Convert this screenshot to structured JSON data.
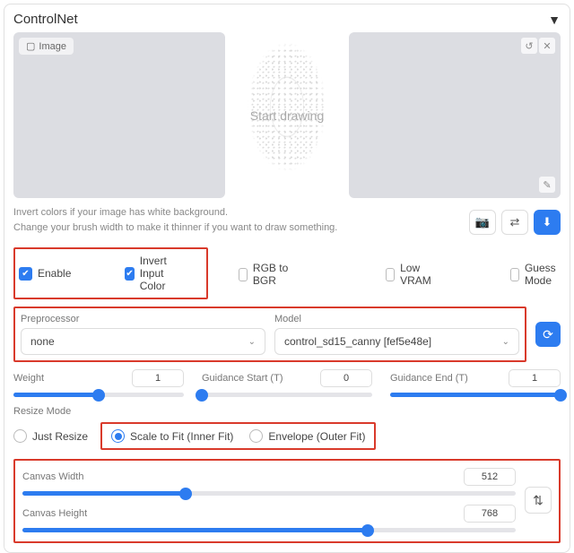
{
  "header": {
    "title": "ControlNet"
  },
  "canvas": {
    "image_chip": "Image",
    "placeholder": "Start drawing"
  },
  "hint": {
    "line1": "Invert colors if your image has white background.",
    "line2": "Change your brush width to make it thinner if you want to draw something."
  },
  "action_buttons": {
    "camera": "📷",
    "swap": "⇄",
    "info": "⬇"
  },
  "checks": {
    "enable": "Enable",
    "invert": "Invert Input Color",
    "rgb": "RGB to BGR",
    "lowvram": "Low VRAM",
    "guess": "Guess Mode"
  },
  "preproc": {
    "label": "Preprocessor",
    "value": "none"
  },
  "model": {
    "label": "Model",
    "value": "control_sd15_canny [fef5e48e]"
  },
  "sliders": {
    "weight": {
      "label": "Weight",
      "value": "1",
      "pct": 50
    },
    "gstart": {
      "label": "Guidance Start (T)",
      "value": "0",
      "pct": 0
    },
    "gend": {
      "label": "Guidance End (T)",
      "value": "1",
      "pct": 100
    }
  },
  "resize": {
    "label": "Resize Mode",
    "just": "Just Resize",
    "scale": "Scale to Fit (Inner Fit)",
    "env": "Envelope (Outer Fit)"
  },
  "canvas_dims": {
    "width": {
      "label": "Canvas Width",
      "value": "512",
      "pct": 33
    },
    "height": {
      "label": "Canvas Height",
      "value": "768",
      "pct": 70
    }
  }
}
